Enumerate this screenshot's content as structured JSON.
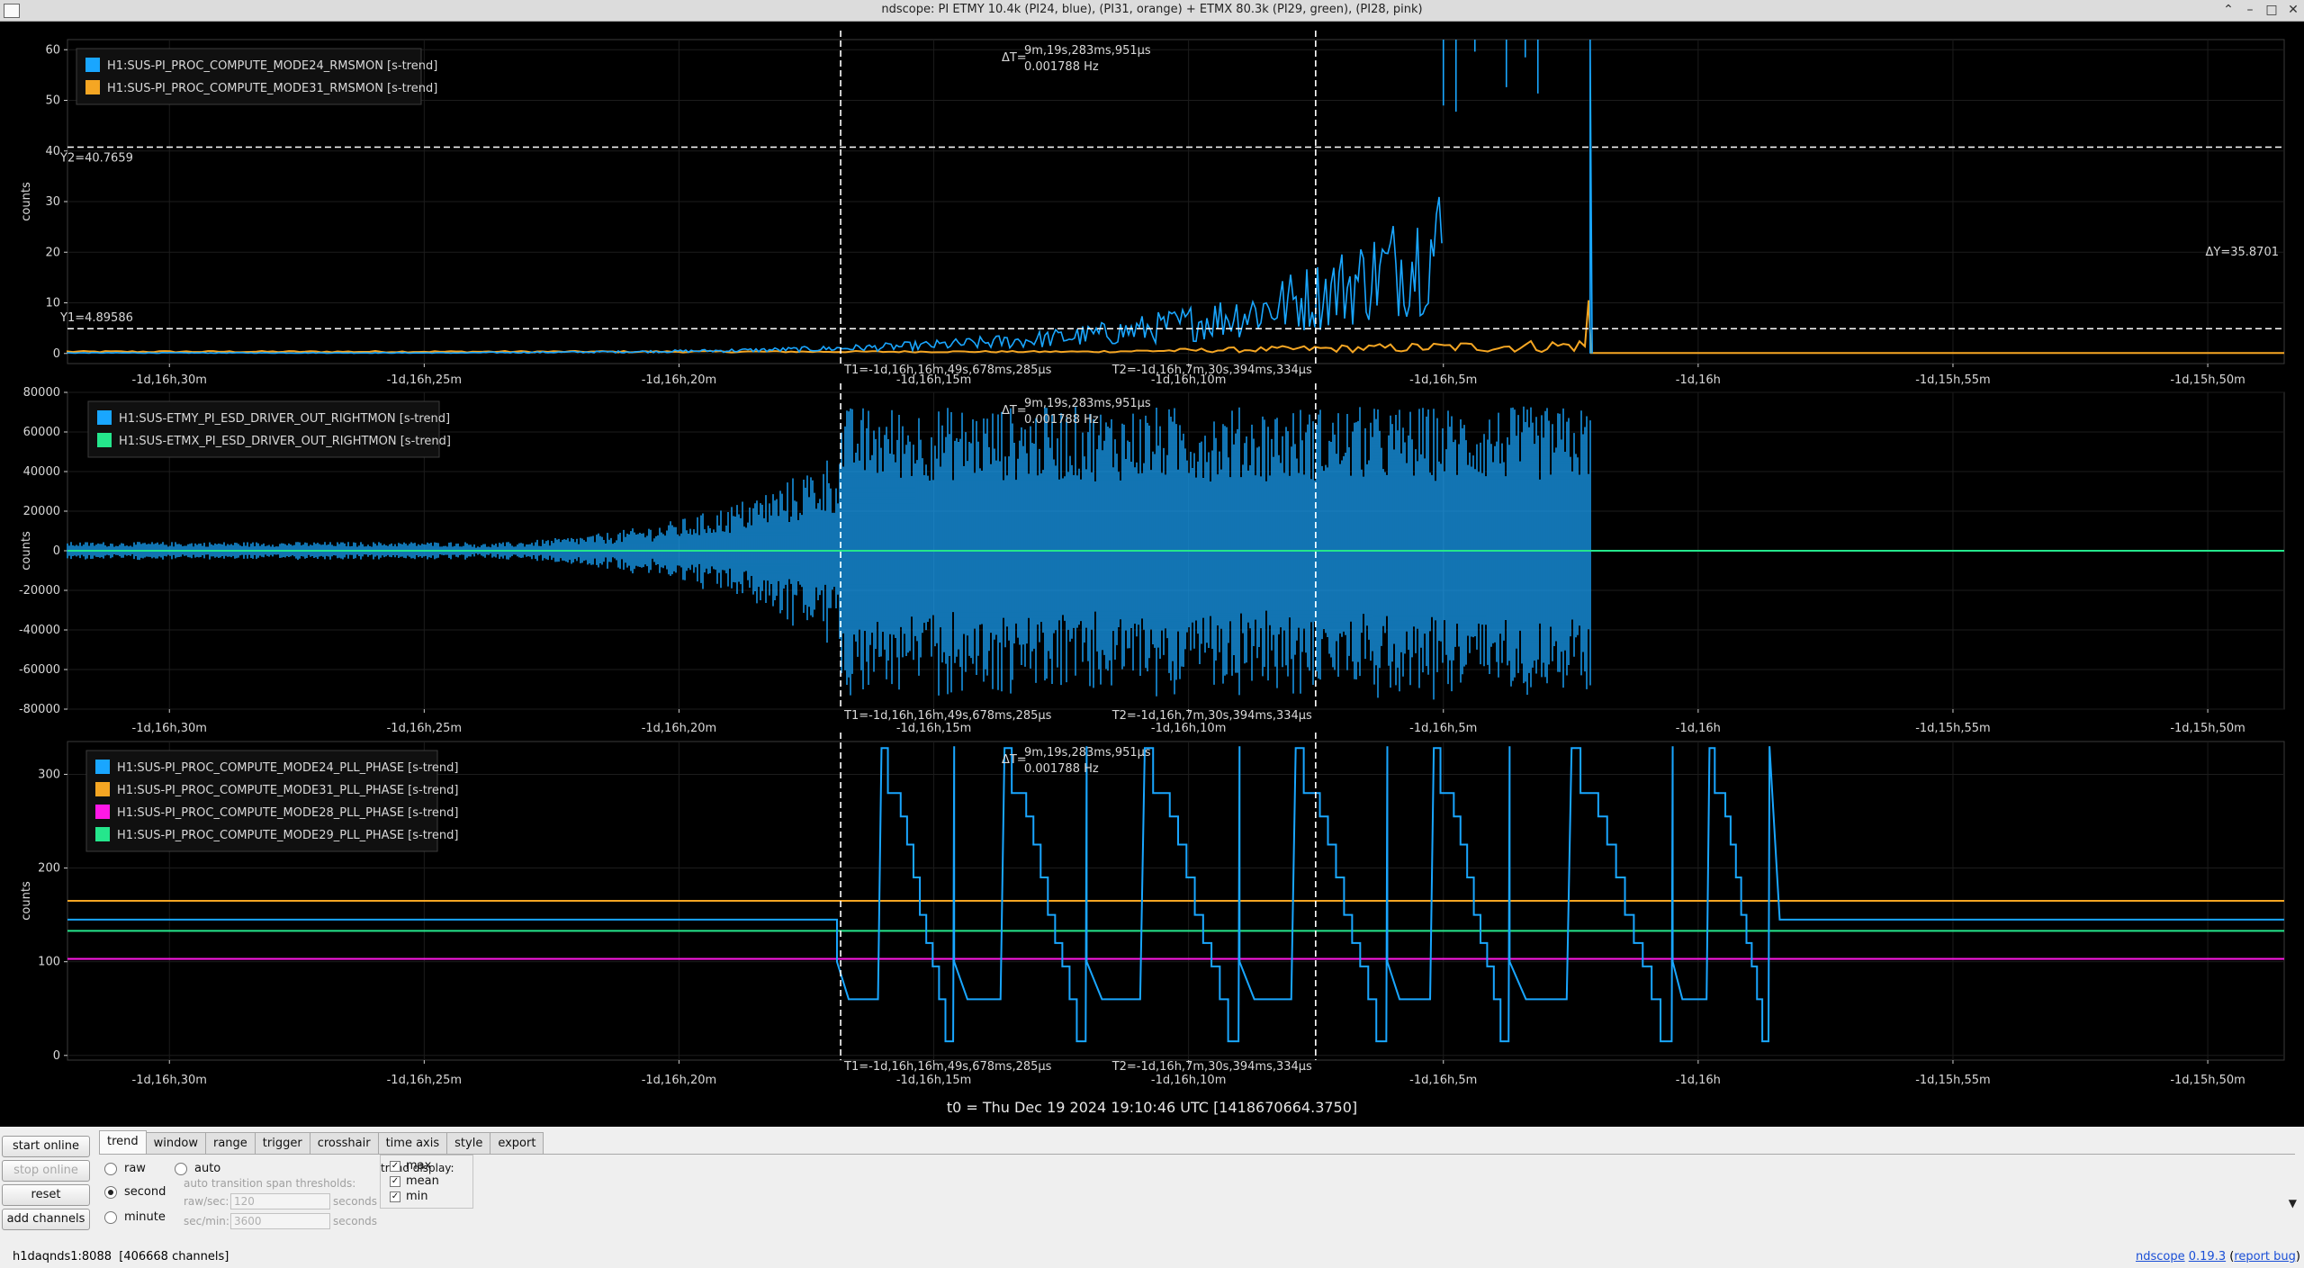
{
  "window": {
    "title": "ndscope: PI ETMY 10.4k (PI24, blue), (PI31, orange) + ETMX 80.3k (PI29, green), (PI28, pink)",
    "buttons": [
      "⌃",
      "–",
      "□",
      "✕"
    ]
  },
  "colors": {
    "blue": "#19a6ff",
    "orange": "#f5a623",
    "green": "#25e68c",
    "pink": "#ff18e6",
    "cursor": "#ffffff",
    "background": "#000000"
  },
  "plots": [
    {
      "id": "rmsmon",
      "ylabel": "counts",
      "yticks": [
        0,
        10,
        20,
        30,
        40,
        50,
        60
      ],
      "legend": [
        {
          "label": "H1:SUS-PI_PROC_COMPUTE_MODE24_RMSMON [s-trend]",
          "color": "blue"
        },
        {
          "label": "H1:SUS-PI_PROC_COMPUTE_MODE31_RMSMON [s-trend]",
          "color": "orange"
        }
      ],
      "ycursors": {
        "y1": "Y1=4.89586",
        "y2": "Y2=40.7659",
        "dy": "ΔY=35.8701",
        "y1_value": 4.89586,
        "y2_value": 40.7659
      },
      "delta": [
        "ΔT=",
        "9m,19s,283ms,951μs",
        "0.001788 Hz"
      ],
      "t1": "T1=-1d,16h,16m,49s,678ms,285μs",
      "t2": "T2=-1d,16h,7m,30s,394ms,334μs"
    },
    {
      "id": "esd",
      "ylabel": "counts",
      "yticks": [
        -80000,
        -60000,
        -40000,
        -20000,
        0,
        20000,
        40000,
        60000,
        80000
      ],
      "legend": [
        {
          "label": "H1:SUS-ETMY_PI_ESD_DRIVER_OUT_RIGHTMON [s-trend]",
          "color": "blue"
        },
        {
          "label": "H1:SUS-ETMX_PI_ESD_DRIVER_OUT_RIGHTMON [s-trend]",
          "color": "green"
        }
      ],
      "delta": [
        "ΔT=",
        "9m,19s,283ms,951μs",
        "0.001788 Hz"
      ],
      "t1": "T1=-1d,16h,16m,49s,678ms,285μs",
      "t2": "T2=-1d,16h,7m,30s,394ms,334μs"
    },
    {
      "id": "pll",
      "ylabel": "counts",
      "yticks": [
        0,
        100,
        200,
        300
      ],
      "legend": [
        {
          "label": "H1:SUS-PI_PROC_COMPUTE_MODE24_PLL_PHASE [s-trend]",
          "color": "blue"
        },
        {
          "label": "H1:SUS-PI_PROC_COMPUTE_MODE31_PLL_PHASE [s-trend]",
          "color": "orange"
        },
        {
          "label": "H1:SUS-PI_PROC_COMPUTE_MODE28_PLL_PHASE [s-trend]",
          "color": "pink"
        },
        {
          "label": "H1:SUS-PI_PROC_COMPUTE_MODE29_PLL_PHASE [s-trend]",
          "color": "green"
        }
      ],
      "levels": {
        "orange": 165,
        "green": 133,
        "pink": 103,
        "blue_base": 145
      },
      "delta": [
        "ΔT=",
        "9m,19s,283ms,951μs",
        "0.001788 Hz"
      ],
      "t1": "T1=-1d,16h,16m,49s,678ms,285μs",
      "t2": "T2=-1d,16h,7m,30s,394ms,334μs"
    }
  ],
  "xticks": [
    "-1d,16h,30m",
    "-1d,16h,25m",
    "-1d,16h,20m",
    "-1d,16h,15m",
    "-1d,16h,10m",
    "-1d,16h,5m",
    "-1d,16h",
    "-1d,15h,55m",
    "-1d,15h,50m"
  ],
  "xtick_minutes": [
    -30,
    -25,
    -20,
    -15,
    -10,
    -5,
    0,
    5,
    10
  ],
  "t0": "t0 = Thu Dec 19 2024 19:10:46 UTC [1418670664.3750]",
  "controls": {
    "start_online": "start online",
    "stop_online": "stop online",
    "reset": "reset",
    "add_channels": "add channels",
    "tabs": [
      "trend",
      "window",
      "range",
      "trigger",
      "crosshair",
      "time axis",
      "style",
      "export"
    ],
    "active_tab": "trend",
    "radio_raw": "raw",
    "radio_second": "second",
    "radio_minute": "minute",
    "radio_auto": "auto",
    "selected_mode": "second",
    "thresholds_label": "auto transition span thresholds:",
    "raw_sec_label": "raw/sec:",
    "raw_sec_value": "120",
    "sec_min_label": "sec/min:",
    "sec_min_value": "3600",
    "seconds_label": "seconds",
    "trend_display_label": "trend display:",
    "max": "max",
    "mean": "mean",
    "min": "min",
    "checked": [
      "max",
      "mean",
      "min"
    ]
  },
  "status": {
    "server": "h1daqnds1:8088",
    "channels": "[406668 channels]",
    "app_link": "ndscope",
    "version": "0.19.3",
    "report_bug": "report bug"
  }
}
